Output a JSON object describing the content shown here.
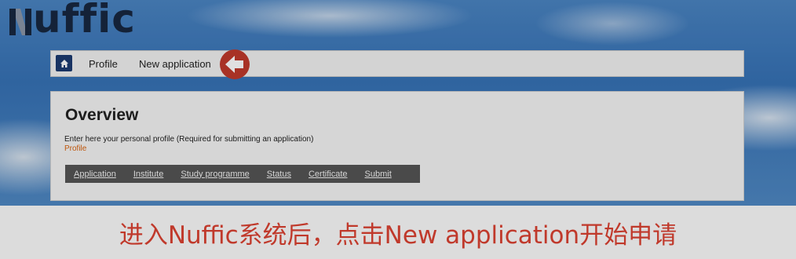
{
  "brand": {
    "logo_text": "uffic",
    "logo_alt": "Nuffic"
  },
  "nav": {
    "home_icon": "home-icon",
    "items": [
      {
        "label": "Profile"
      },
      {
        "label": "New application"
      }
    ],
    "highlight_icon": "arrow-left-icon"
  },
  "overview": {
    "title": "Overview",
    "description": "Enter here your personal profile (Required for submitting an application)",
    "profile_link": "Profile",
    "steps": [
      {
        "label": "Application"
      },
      {
        "label": "Institute"
      },
      {
        "label": "Study programme"
      },
      {
        "label": "Status"
      },
      {
        "label": "Certificate"
      },
      {
        "label": "Submit"
      }
    ]
  },
  "caption": {
    "text": "进入Nuffic系统后，点击New application开始申请"
  },
  "colors": {
    "accent_red": "#c0392b",
    "link_orange": "#d9630e",
    "nav_dark_blue": "#1c3b70",
    "step_bar": "#555555"
  }
}
